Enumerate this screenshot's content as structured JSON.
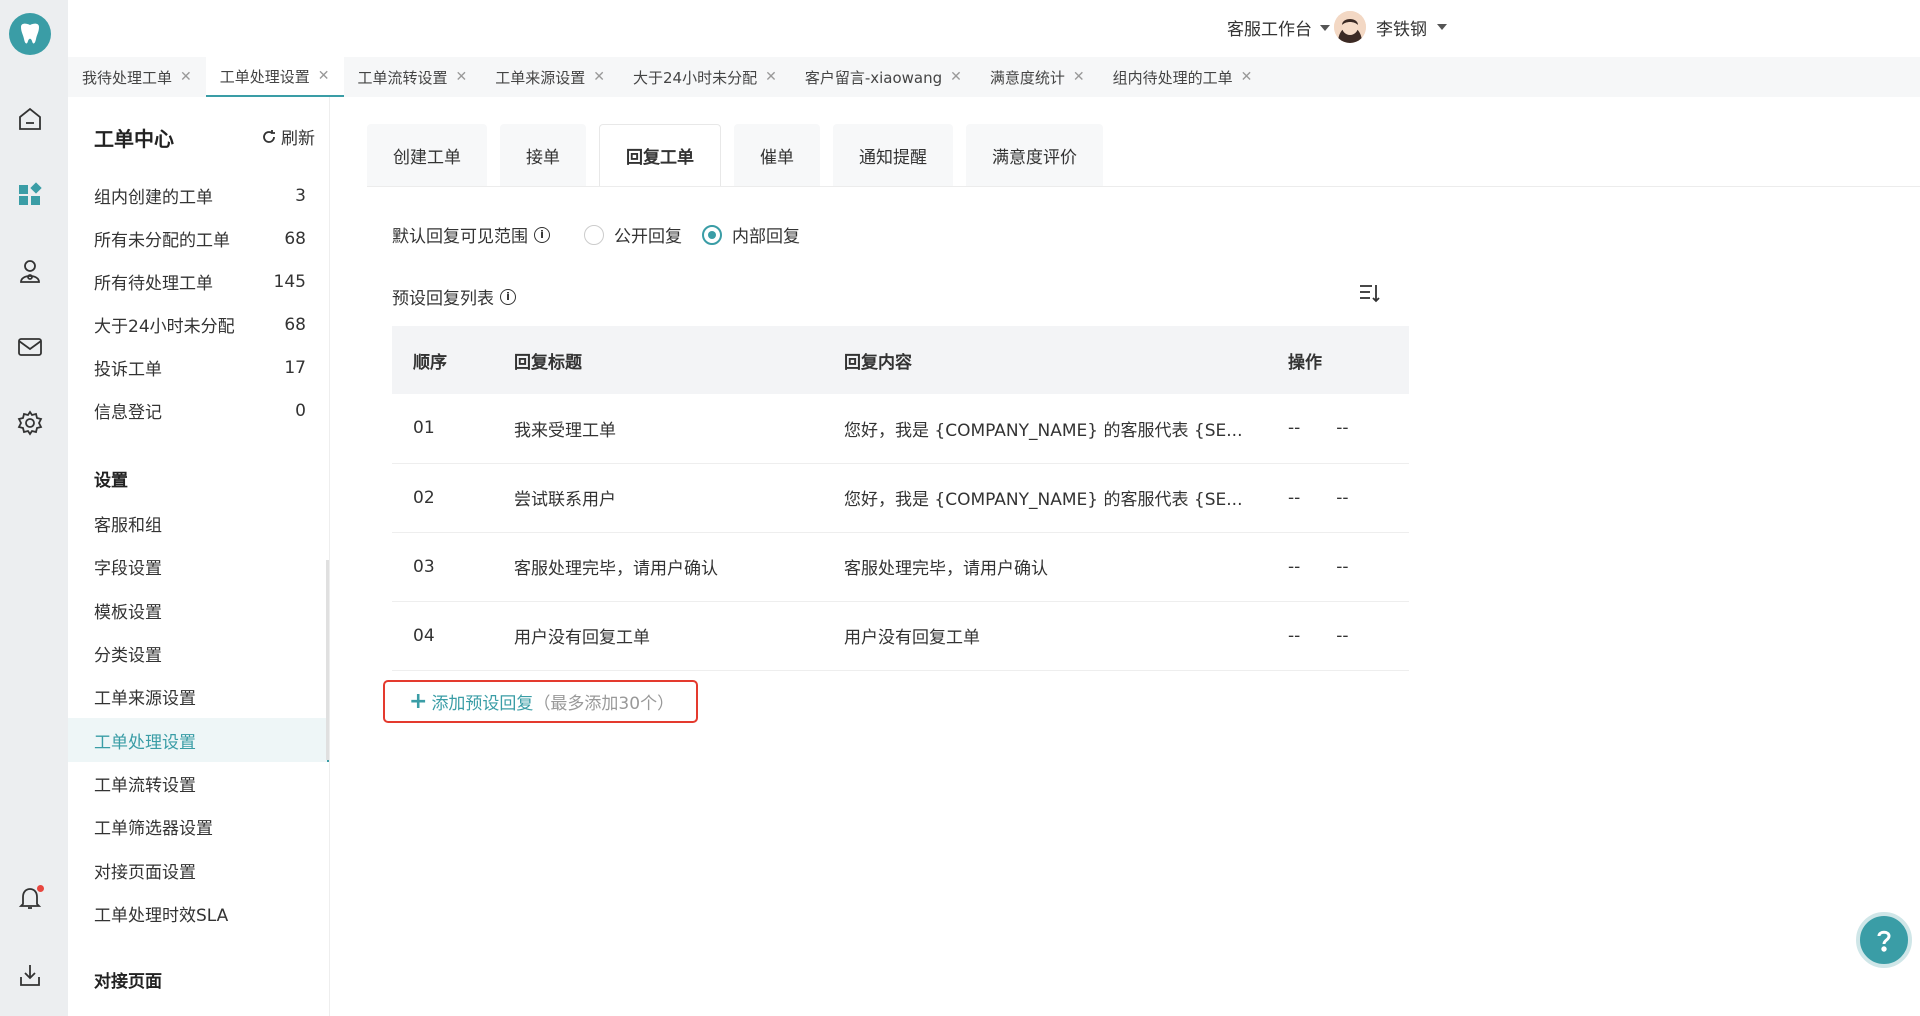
{
  "topbar": {
    "workbench_label": "客服工作台",
    "user_name": "李铁钢"
  },
  "tabs": [
    {
      "label": "我待处理工单",
      "active": false
    },
    {
      "label": "工单处理设置",
      "active": true
    },
    {
      "label": "工单流转设置",
      "active": false
    },
    {
      "label": "工单来源设置",
      "active": false
    },
    {
      "label": "大于24小时未分配",
      "active": false
    },
    {
      "label": "客户留言-xiaowang",
      "active": false
    },
    {
      "label": "满意度统计",
      "active": false
    },
    {
      "label": "组内待处理的工单",
      "active": false
    }
  ],
  "sidebar": {
    "title": "工单中心",
    "refresh_label": "刷新",
    "items": [
      {
        "label": "组内创建的工单",
        "count": "3"
      },
      {
        "label": "所有未分配的工单",
        "count": "68"
      },
      {
        "label": "所有待处理工单",
        "count": "145"
      },
      {
        "label": "大于24小时未分配",
        "count": "68"
      },
      {
        "label": "投诉工单",
        "count": "17"
      },
      {
        "label": "信息登记",
        "count": "0"
      }
    ],
    "settings_title": "设置",
    "settings": [
      {
        "label": "客服和组",
        "active": false
      },
      {
        "label": "字段设置",
        "active": false
      },
      {
        "label": "模板设置",
        "active": false
      },
      {
        "label": "分类设置",
        "active": false
      },
      {
        "label": "工单来源设置",
        "active": false
      },
      {
        "label": "工单处理设置",
        "active": true
      },
      {
        "label": "工单流转设置",
        "active": false
      },
      {
        "label": "工单筛选器设置",
        "active": false
      },
      {
        "label": "对接页面设置",
        "active": false
      },
      {
        "label": "工单处理时效SLA",
        "active": false
      }
    ],
    "dock_title": "对接页面"
  },
  "main": {
    "page_tabs": [
      {
        "label": "创建工单",
        "active": false
      },
      {
        "label": "接单",
        "active": false
      },
      {
        "label": "回复工单",
        "active": true
      },
      {
        "label": "催单",
        "active": false
      },
      {
        "label": "通知提醒",
        "active": false
      },
      {
        "label": "满意度评价",
        "active": false
      }
    ],
    "visibility_label": "默认回复可见范围",
    "visibility_options": [
      {
        "label": "公开回复",
        "selected": false
      },
      {
        "label": "内部回复",
        "selected": true
      }
    ],
    "list_title": "预设回复列表",
    "table_headers": [
      "顺序",
      "回复标题",
      "回复内容",
      "操作"
    ],
    "rows": [
      {
        "order": "01",
        "title": "我来受理工单",
        "content": "您好，我是 {COMPANY_NAME} 的客服代表 {SE...",
        "op1": "--",
        "op2": "--"
      },
      {
        "order": "02",
        "title": "尝试联系用户",
        "content": "您好，我是 {COMPANY_NAME} 的客服代表 {SE...",
        "op1": "--",
        "op2": "--"
      },
      {
        "order": "03",
        "title": "客服处理完毕，请用户确认",
        "content": "客服处理完毕，请用户确认",
        "op1": "--",
        "op2": "--"
      },
      {
        "order": "04",
        "title": "用户没有回复工单",
        "content": "用户没有回复工单",
        "op1": "--",
        "op2": "--"
      }
    ],
    "add_button": {
      "label": "添加预设回复",
      "hint": "（最多添加30个）"
    }
  },
  "colors": {
    "accent": "#3a9da6",
    "highlight": "#e43a2e"
  }
}
